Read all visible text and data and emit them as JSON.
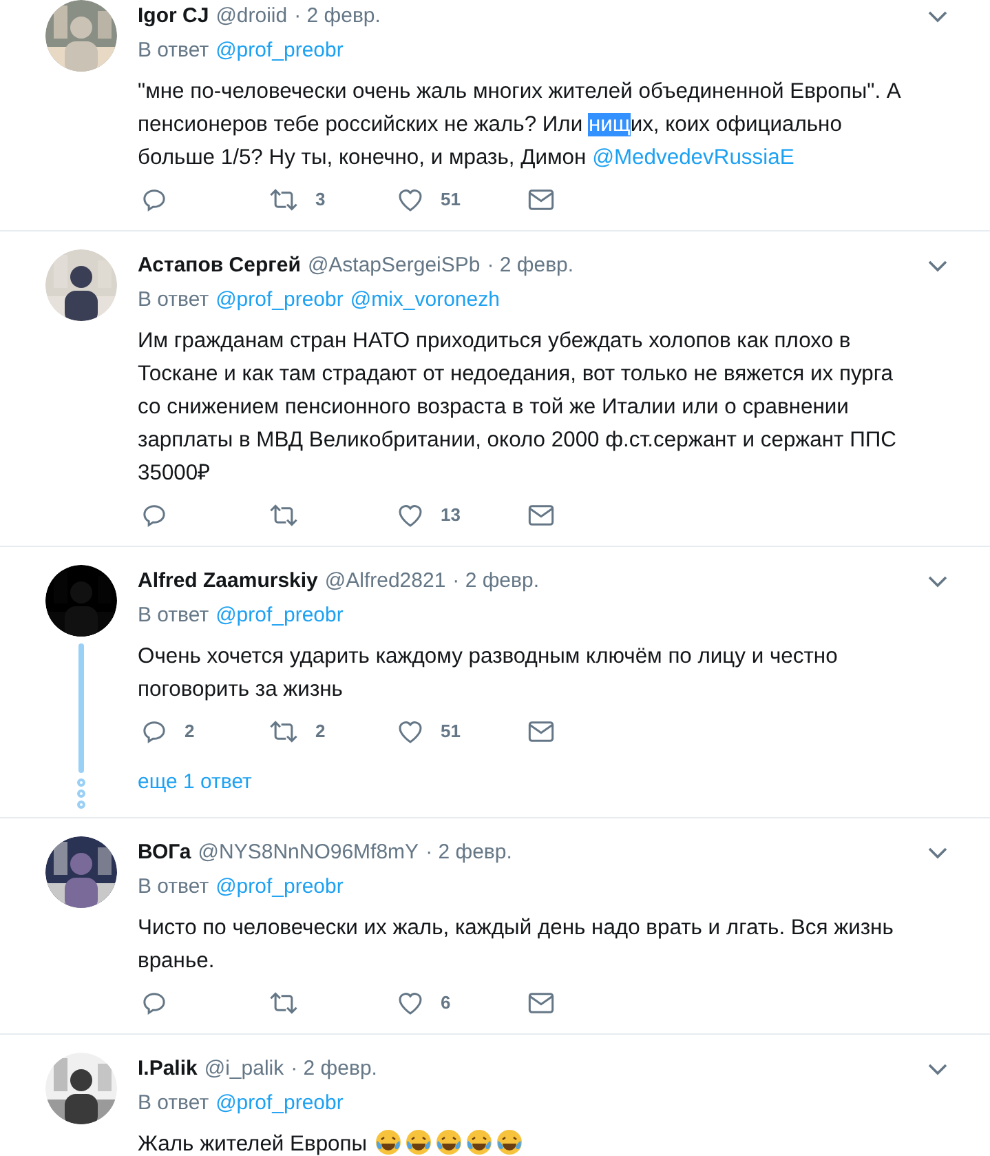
{
  "tweets": [
    {
      "name": "Igor CJ",
      "handle": "@droiid",
      "date": "· 2 февр.",
      "reply_label": "В ответ",
      "reply_to": [
        "@prof_preobr"
      ],
      "body": [
        {
          "kind": "text",
          "text": "\"мне по-человечески очень жаль многих жителей объединенной Европы\". А пенсионеров тебе российских не жаль? Или "
        },
        {
          "kind": "selected",
          "text": "нищ"
        },
        {
          "kind": "text",
          "text": "их, коих официально больше 1/5? Ну ты, конечно, и мразь, Димон "
        },
        {
          "kind": "mention",
          "text": "@MedvedevRussiaE"
        }
      ],
      "retweets": "3",
      "likes": "51",
      "thread": false
    },
    {
      "name": "Астапов Сергей",
      "handle": "@AstapSergeiSPb",
      "date": "· 2 февр.",
      "reply_label": "В ответ",
      "reply_to": [
        "@prof_preobr",
        "@mix_voronezh"
      ],
      "body": [
        {
          "kind": "text",
          "text": "Им гражданам стран НАТО приходиться убеждать холопов как плохо в Тоскане и как там страдают от недоедания, вот только не вяжется их пурга со снижением пенсионного возраста в той же Италии или о сравнении зарплаты в МВД Великобритании, около 2000 ф.ст.сержант и сержант ППС 35000₽"
        }
      ],
      "likes": "13",
      "thread": false
    },
    {
      "name": "Alfred Zaamurskiy",
      "handle": "@Alfred2821",
      "date": "· 2 февр.",
      "reply_label": "В ответ",
      "reply_to": [
        "@prof_preobr"
      ],
      "body": [
        {
          "kind": "text",
          "text": "Очень хочется ударить каждому разводным ключём по лицу и честно поговорить за жизнь"
        }
      ],
      "replies": "2",
      "retweets": "2",
      "likes": "51",
      "thread": true,
      "more_replies": "еще 1 ответ"
    },
    {
      "name": "ВОГа",
      "handle": "@NYS8NnNO96Mf8mY",
      "date": "· 2 февр.",
      "reply_label": "В ответ",
      "reply_to": [
        "@prof_preobr"
      ],
      "body": [
        {
          "kind": "text",
          "text": "Чисто по человечески их жаль, каждый день надо врать и лгать. Вся жизнь вранье."
        }
      ],
      "likes": "6",
      "thread": false
    },
    {
      "name": "I.Palik",
      "handle": "@i_palik",
      "date": "· 2 февр.",
      "reply_label": "В ответ",
      "reply_to": [
        "@prof_preobr"
      ],
      "body": [
        {
          "kind": "text",
          "text": "Жаль жителей Европы "
        },
        {
          "kind": "emoji"
        },
        {
          "kind": "emoji"
        },
        {
          "kind": "emoji"
        },
        {
          "kind": "emoji"
        },
        {
          "kind": "emoji"
        }
      ],
      "thread": false
    }
  ]
}
